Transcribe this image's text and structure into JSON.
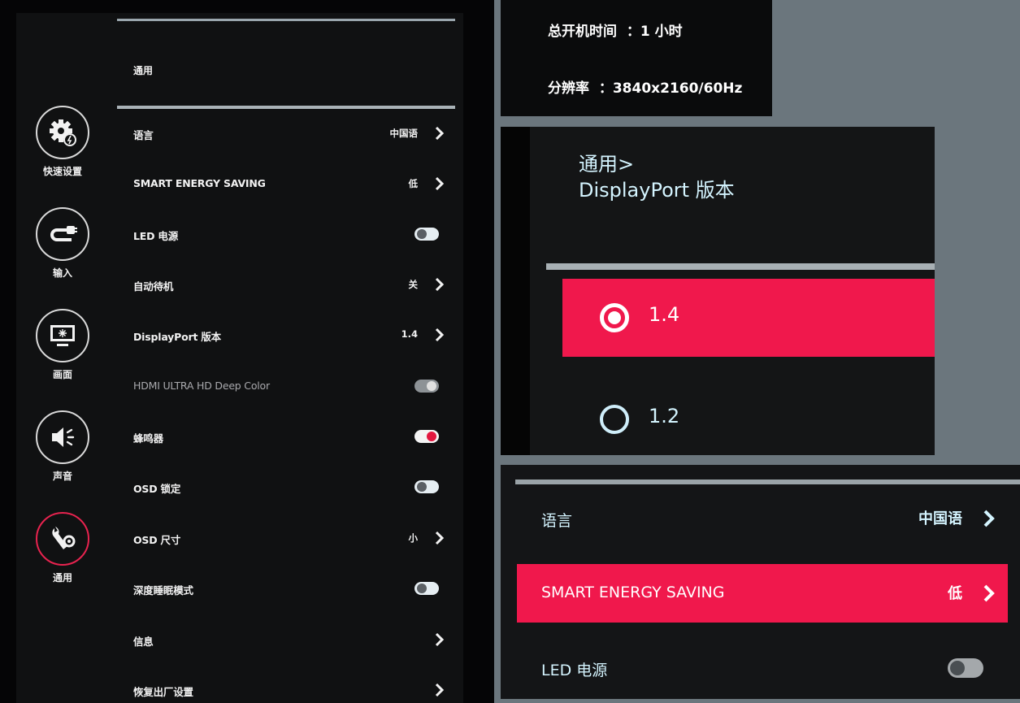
{
  "sidebar": {
    "items": [
      {
        "label": "快速设置",
        "icon": "gear-badge-icon",
        "active": false
      },
      {
        "label": "输入",
        "icon": "input-cable-icon",
        "active": false
      },
      {
        "label": "画面",
        "icon": "monitor-icon",
        "active": false
      },
      {
        "label": "声音",
        "icon": "speaker-icon",
        "active": false
      },
      {
        "label": "通用",
        "icon": "wrench-gear-icon",
        "active": true
      }
    ]
  },
  "menu": {
    "title": "通用",
    "rows": [
      {
        "label": "语言",
        "value": "中国语",
        "control": "chevron"
      },
      {
        "label": "SMART ENERGY SAVING",
        "value": "低",
        "control": "chevron"
      },
      {
        "label": "LED 电源",
        "value": "",
        "control": "toggle-off"
      },
      {
        "label": "自动待机",
        "value": "关",
        "control": "chevron"
      },
      {
        "label": "DisplayPort 版本",
        "value": "1.4",
        "control": "chevron"
      },
      {
        "label": "HDMI ULTRA HD Deep Color",
        "value": "",
        "control": "toggle-disabled"
      },
      {
        "label": "蜂鸣器",
        "value": "",
        "control": "toggle-on"
      },
      {
        "label": "OSD 锁定",
        "value": "",
        "control": "toggle-off"
      },
      {
        "label": "OSD 尺寸",
        "value": "小",
        "control": "chevron"
      },
      {
        "label": "深度睡眠模式",
        "value": "",
        "control": "toggle-off"
      },
      {
        "label": "信息",
        "value": "",
        "control": "chevron"
      },
      {
        "label": "恢复出厂设置",
        "value": "",
        "control": "chevron"
      }
    ]
  },
  "info": {
    "uptime": "总开机时间  ：1 小时",
    "resolution": "分辨率  ：3840x2160/60Hz"
  },
  "dp_panel": {
    "crumb": "通用>",
    "title": "DisplayPort 版本",
    "options": [
      {
        "label": "1.4",
        "selected": true
      },
      {
        "label": "1.2",
        "selected": false
      }
    ]
  },
  "zoom_panel": {
    "rows": [
      {
        "label": "语言",
        "value": "中国语",
        "control": "chevron",
        "selected": false
      },
      {
        "label": "SMART ENERGY SAVING",
        "value": "低",
        "control": "chevron",
        "selected": true
      },
      {
        "label": "LED 电源",
        "value": "",
        "control": "toggle-off",
        "selected": false
      }
    ]
  },
  "colors": {
    "accent": "#f0184c",
    "background": "#101112",
    "text_highlight": "#d4f4ff"
  }
}
